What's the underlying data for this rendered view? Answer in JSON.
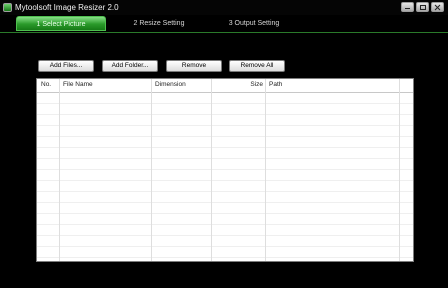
{
  "window": {
    "title": "Mytoolsoft Image Resizer 2.0"
  },
  "tabs": [
    {
      "label": "1 Select Picture"
    },
    {
      "label": "2 Resize Setting"
    },
    {
      "label": "3 Output Setting"
    }
  ],
  "toolbar": {
    "add_files": "Add Files...",
    "add_folder": "Add Folder...",
    "remove": "Remove",
    "remove_all": "Remove All"
  },
  "table": {
    "columns": [
      "No.",
      "File Name",
      "Dimension",
      "Size",
      "Path"
    ],
    "rows": []
  },
  "colors": {
    "accent": "#2a9a2a",
    "background": "#000000"
  }
}
